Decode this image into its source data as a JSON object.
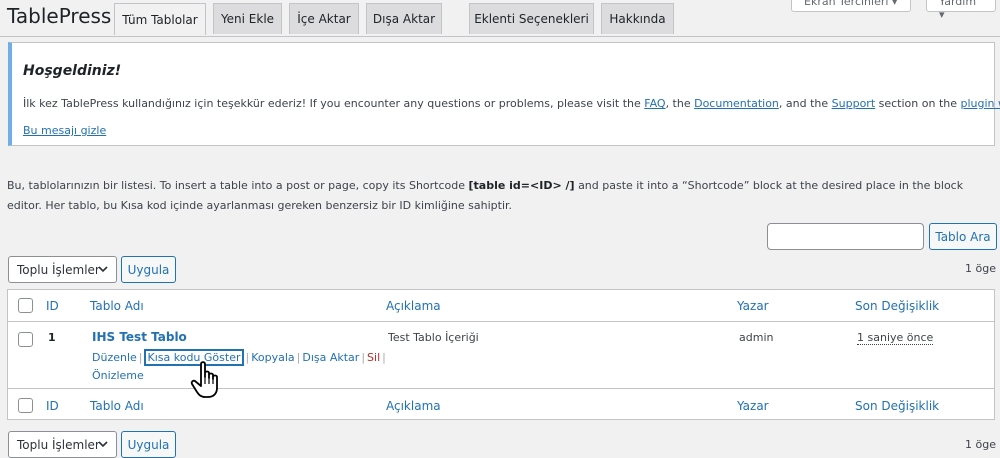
{
  "header": {
    "brand": "TablePress",
    "screen_options": "Ekran Tercihleri",
    "help": "Yardım"
  },
  "tabs": [
    {
      "label": "Tüm Tablolar",
      "active": true
    },
    {
      "label": "Yeni Ekle"
    },
    {
      "label": "İçe Aktar"
    },
    {
      "label": "Dışa Aktar"
    },
    {
      "label": "Eklenti Seçenekleri"
    },
    {
      "label": "Hakkında"
    }
  ],
  "notice": {
    "title": "Hoşgeldiniz!",
    "text_1": "İlk kez TablePress kullandığınız için teşekkür ederiz! If you encounter any questions or problems, please visit the ",
    "faq": "FAQ",
    "text_2": ", the ",
    "documentation": "Documentation",
    "text_3": ", and the ",
    "support": "Support",
    "text_4": " section on the ",
    "plugin_website": "plugin website",
    "text_5": ".",
    "hide_link": "Bu mesajı gizle"
  },
  "intro": {
    "text_1": "Bu, tablolarınızın bir listesi. To insert a table into a post or page, copy its Shortcode ",
    "shortcode": "[table id=<ID> /]",
    "text_2": " and paste it into a “Shortcode” block at the desired place in the block editor. Her tablo, bu Kısa kod içinde ayarlanması gereken benzersiz bir ID kimliğine sahiptir."
  },
  "search": {
    "placeholder": "",
    "button": "Tablo Ara"
  },
  "bulk": {
    "selected": "Toplu İşlemler",
    "apply": "Uygula",
    "count": "1 öge"
  },
  "table": {
    "columns": [
      "ID",
      "Tablo Adı",
      "Açıklama",
      "Yazar",
      "Son Değişiklik"
    ],
    "rows": [
      {
        "id": "1",
        "name": "IHS Test Tablo",
        "description": "Test Tablo İçeriği",
        "author": "admin",
        "modified": "1 saniye önce",
        "actions": {
          "edit": "Düzenle",
          "shortcode": "Kısa kodu Göster",
          "copy": "Kopyala",
          "export": "Dışa Aktar",
          "delete": "Sil",
          "preview": "Önizleme"
        }
      }
    ]
  },
  "colors": {
    "link": "#2271b1",
    "notice_border": "#72aee6",
    "delete": "#b32d2e"
  }
}
